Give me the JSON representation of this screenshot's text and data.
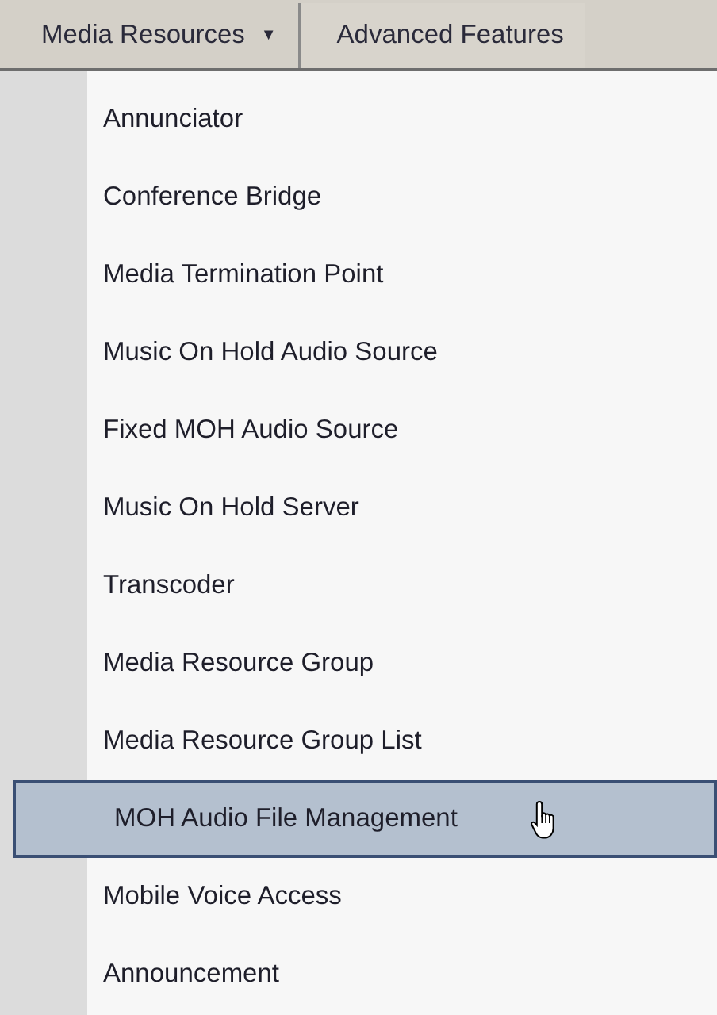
{
  "menu_bar": [
    {
      "label": "Media Resources",
      "caret": "▼",
      "selected": true
    },
    {
      "label": "Advanced Features",
      "selected": false
    }
  ],
  "menu_items": [
    {
      "label": "Annunciator",
      "selected": false
    },
    {
      "label": "Conference Bridge",
      "selected": false
    },
    {
      "label": "Media Termination Point",
      "selected": false
    },
    {
      "label": "Music On Hold Audio Source",
      "selected": false
    },
    {
      "label": "Fixed MOH Audio Source",
      "selected": false
    },
    {
      "label": "Music On Hold Server",
      "selected": false
    },
    {
      "label": "Transcoder",
      "selected": false
    },
    {
      "label": "Media Resource Group",
      "selected": false
    },
    {
      "label": "Media Resource Group List",
      "selected": false
    },
    {
      "label": "MOH Audio File Management",
      "selected": true
    },
    {
      "label": "Mobile Voice Access",
      "selected": false
    },
    {
      "label": "Announcement",
      "selected": false
    }
  ]
}
